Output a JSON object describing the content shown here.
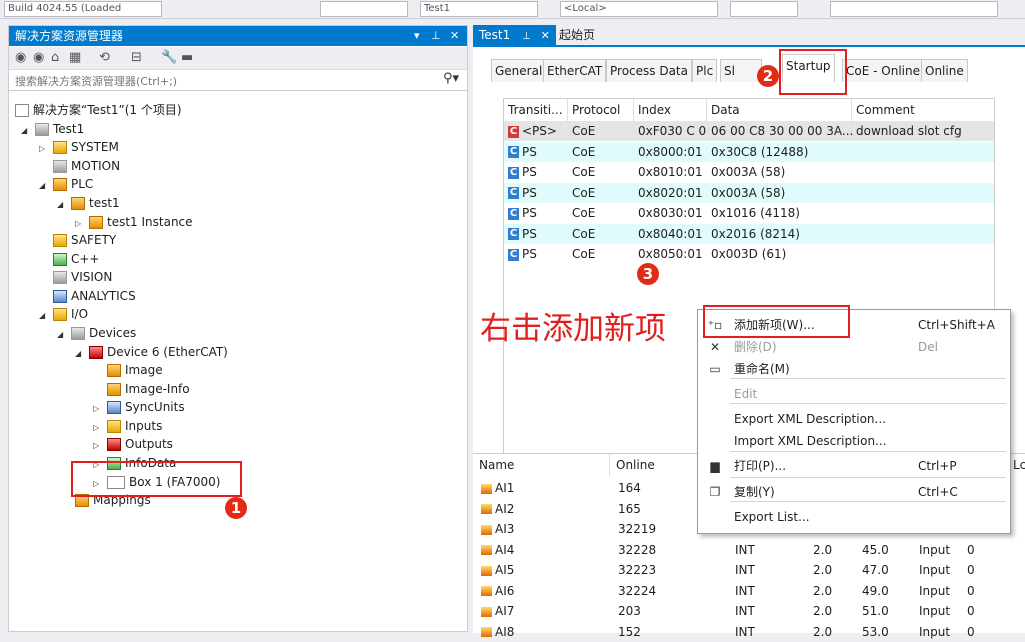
{
  "topbar": {
    "build_text": "Build 4024.55 (Loaded",
    "target_text": "<Local>",
    "tab_text": "Test1"
  },
  "explorer": {
    "title": "解决方案资源管理器",
    "search_placeholder": "搜索解决方案资源管理器(Ctrl+;)",
    "tree": [
      {
        "label": "解决方案“Test1”(1 个项目)",
        "icon": "solution-icon"
      },
      {
        "label": "Test1",
        "icon": "project-icon"
      },
      {
        "label": "SYSTEM",
        "icon": "system-icon"
      },
      {
        "label": "MOTION",
        "icon": "motion-icon"
      },
      {
        "label": "PLC",
        "icon": "plc-icon"
      },
      {
        "label": "test1",
        "icon": "plc-project-icon"
      },
      {
        "label": "test1 Instance",
        "icon": "instance-icon"
      },
      {
        "label": "SAFETY",
        "icon": "safety-icon"
      },
      {
        "label": "C++",
        "icon": "cpp-icon"
      },
      {
        "label": "VISION",
        "icon": "vision-icon"
      },
      {
        "label": "ANALYTICS",
        "icon": "analytics-icon"
      },
      {
        "label": "I/O",
        "icon": "io-icon"
      },
      {
        "label": "Devices",
        "icon": "devices-icon"
      },
      {
        "label": "Device 6 (EtherCAT)",
        "icon": "ethercat-icon"
      },
      {
        "label": "Image",
        "icon": "image-icon"
      },
      {
        "label": "Image-Info",
        "icon": "image-info-icon"
      },
      {
        "label": "SyncUnits",
        "icon": "syncunits-icon"
      },
      {
        "label": "Inputs",
        "icon": "inputs-icon"
      },
      {
        "label": "Outputs",
        "icon": "outputs-icon"
      },
      {
        "label": "InfoData",
        "icon": "infodata-icon"
      },
      {
        "label": "Box 1 (FA7000)",
        "icon": "box-icon"
      },
      {
        "label": "Mappings",
        "icon": "mappings-icon"
      }
    ]
  },
  "doc": {
    "tabs": [
      {
        "label": "Test1"
      },
      {
        "label": "起始页"
      }
    ],
    "inner_tabs": [
      "General",
      "EtherCAT",
      "Process Data",
      "Plc",
      "Sl",
      "Startup",
      "CoE - Online",
      "Online"
    ],
    "startup": {
      "headers": [
        "Transiti...",
        "Protocol",
        "Index",
        "Data",
        "Comment"
      ],
      "rows": [
        {
          "badge": "C",
          "transition": "<PS>",
          "protocol": "CoE",
          "index": "0xF030 C 0",
          "data": "06 00 C8 30 00 00 3A...",
          "comment": "download slot cfg"
        },
        {
          "badge": "C",
          "transition": "PS",
          "protocol": "CoE",
          "index": "0x8000:01",
          "data": "0x30C8 (12488)",
          "comment": ""
        },
        {
          "badge": "C",
          "transition": "PS",
          "protocol": "CoE",
          "index": "0x8010:01",
          "data": "0x003A (58)",
          "comment": ""
        },
        {
          "badge": "C",
          "transition": "PS",
          "protocol": "CoE",
          "index": "0x8020:01",
          "data": "0x003A (58)",
          "comment": ""
        },
        {
          "badge": "C",
          "transition": "PS",
          "protocol": "CoE",
          "index": "0x8030:01",
          "data": "0x1016 (4118)",
          "comment": ""
        },
        {
          "badge": "C",
          "transition": "PS",
          "protocol": "CoE",
          "index": "0x8040:01",
          "data": "0x2016 (8214)",
          "comment": ""
        },
        {
          "badge": "C",
          "transition": "PS",
          "protocol": "CoE",
          "index": "0x8050:01",
          "data": "0x003D (61)",
          "comment": ""
        }
      ]
    },
    "vars": {
      "headers": [
        "Name",
        "Online"
      ],
      "rows": [
        {
          "name": "AI1",
          "online": "164",
          "type": "",
          "size": "",
          "addr": "",
          "io": "",
          "user": ""
        },
        {
          "name": "AI2",
          "online": "165",
          "type": "",
          "size": "",
          "addr": "",
          "io": "",
          "user": ""
        },
        {
          "name": "AI3",
          "online": "32219",
          "type": "",
          "size": "",
          "addr": "",
          "io": "",
          "user": ""
        },
        {
          "name": "AI4",
          "online": "32228",
          "type": "INT",
          "size": "2.0",
          "addr": "45.0",
          "io": "Input",
          "user": "0"
        },
        {
          "name": "AI5",
          "online": "32223",
          "type": "INT",
          "size": "2.0",
          "addr": "47.0",
          "io": "Input",
          "user": "0"
        },
        {
          "name": "AI6",
          "online": "32224",
          "type": "INT",
          "size": "2.0",
          "addr": "49.0",
          "io": "Input",
          "user": "0"
        },
        {
          "name": "AI7",
          "online": "203",
          "type": "INT",
          "size": "2.0",
          "addr": "51.0",
          "io": "Input",
          "user": "0"
        },
        {
          "name": "AI8",
          "online": "152",
          "type": "INT",
          "size": "2.0",
          "addr": "53.0",
          "io": "Input",
          "user": "0"
        }
      ],
      "right_header": "Lc"
    }
  },
  "context_menu": {
    "items": [
      {
        "label": "添加新项(W)...",
        "shortcut": "Ctrl+Shift+A",
        "icon": "add-item-icon",
        "disabled": false
      },
      {
        "label": "删除(D)",
        "shortcut": "Del",
        "icon": "delete-icon",
        "disabled": true
      },
      {
        "label": "重命名(M)",
        "shortcut": "",
        "icon": "rename-icon",
        "disabled": false
      },
      {
        "label": "Edit",
        "shortcut": "",
        "icon": "",
        "disabled": true
      },
      {
        "label": "Export XML Description...",
        "shortcut": "",
        "icon": "",
        "disabled": false
      },
      {
        "label": "Import XML Description...",
        "shortcut": "",
        "icon": "",
        "disabled": false
      },
      {
        "label": "打印(P)...",
        "shortcut": "Ctrl+P",
        "icon": "print-icon",
        "disabled": false
      },
      {
        "label": "复制(Y)",
        "shortcut": "Ctrl+C",
        "icon": "copy-icon",
        "disabled": false
      },
      {
        "label": "Export List...",
        "shortcut": "",
        "icon": "",
        "disabled": false
      }
    ]
  },
  "annotations": {
    "instruction": "右击添加新项",
    "step1": "1",
    "step2": "2",
    "step3": "3",
    "color": "#e02020"
  }
}
